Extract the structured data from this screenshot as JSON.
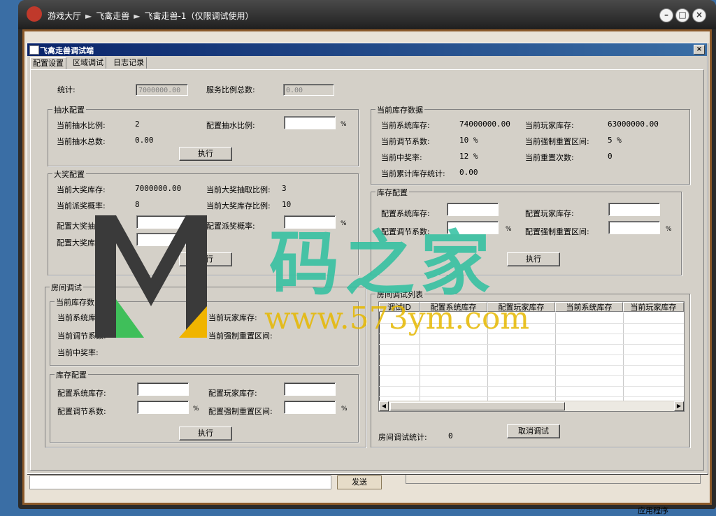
{
  "outer": {
    "breadcrumb": [
      "游戏大厅",
      "飞禽走兽",
      "飞禽走兽-1（仅限调试使用）"
    ],
    "send_label": "发送",
    "corner_text": "应用程序"
  },
  "dialog": {
    "title": "飞禽走兽调试端",
    "close_glyph": "×",
    "tabs": [
      "配置设置",
      "区域调试",
      "日志记录"
    ],
    "stats": {
      "total_label": "统计:",
      "total_value": "7000000.00",
      "service_label": "服务比例总数:",
      "service_value": "0.00"
    },
    "draw": {
      "title": "抽水配置",
      "cur_ratio_label": "当前抽水比例:",
      "cur_ratio_value": "2",
      "cfg_ratio_label": "配置抽水比例:",
      "total_label": "当前抽水总数:",
      "total_value": "0.00",
      "exec_label": "执行"
    },
    "jackpot": {
      "title": "大奖配置",
      "stock_label": "当前大奖库存:",
      "stock_value": "7000000.00",
      "draw_ratio_label": "当前大奖抽取比例:",
      "draw_ratio_value": "3",
      "prob_label": "当前派奖概率:",
      "prob_value": "8",
      "stock_ratio_label": "当前大奖库存比例:",
      "stock_ratio_value": "10",
      "cfg_draw_label": "配置大奖抽",
      "cfg_prob_label": "配置派奖概率:",
      "cfg_stock_label": "配置大奖库",
      "exec_label": "执行"
    },
    "stock_data": {
      "title": "当前库存数据",
      "sys_label": "当前系统库存:",
      "sys_value": "74000000.00",
      "player_label": "当前玩家库存:",
      "player_value": "63000000.00",
      "adj_label": "当前调节系数:",
      "adj_value": "10 %",
      "reset_label": "当前强制重置区间:",
      "reset_value": "5 %",
      "win_label": "当前中奖率:",
      "win_value": "12 %",
      "reset_count_label": "当前重置次数:",
      "reset_count_value": "0",
      "acc_label": "当前累计库存统计:",
      "acc_value": "0.00"
    },
    "stock_cfg": {
      "title": "库存配置",
      "sys_label": "配置系统库存:",
      "player_label": "配置玩家库存:",
      "adj_label": "配置调节系数:",
      "reset_label": "配置强制重置区间:",
      "exec_label": "执行"
    },
    "room": {
      "title": "房间调试",
      "cur_title": "当前库存数",
      "sys_label": "当前系统库存:",
      "player_label": "当前玩家库存:",
      "adj_label": "当前调节系数:",
      "reset_label": "当前强制重置区间:",
      "win_label": "当前中奖率:",
      "cfg_title": "库存配置",
      "cfg_sys_label": "配置系统库存:",
      "cfg_player_label": "配置玩家库存:",
      "cfg_adj_label": "配置调节系数:",
      "cfg_reset_label": "配置强制重置区间:",
      "exec_label": "执行"
    },
    "room_list": {
      "title": "房间调试列表",
      "columns": [
        "调试ID",
        "配置系统库存",
        "配置玩家库存",
        "当前系统库存",
        "当前玩家库存"
      ],
      "stat_label": "房间调试统计:",
      "stat_value": "0",
      "cancel_label": "取消调试"
    },
    "pct": "%"
  },
  "watermark": {
    "text": "码之家",
    "url": "www.573ym.com"
  }
}
